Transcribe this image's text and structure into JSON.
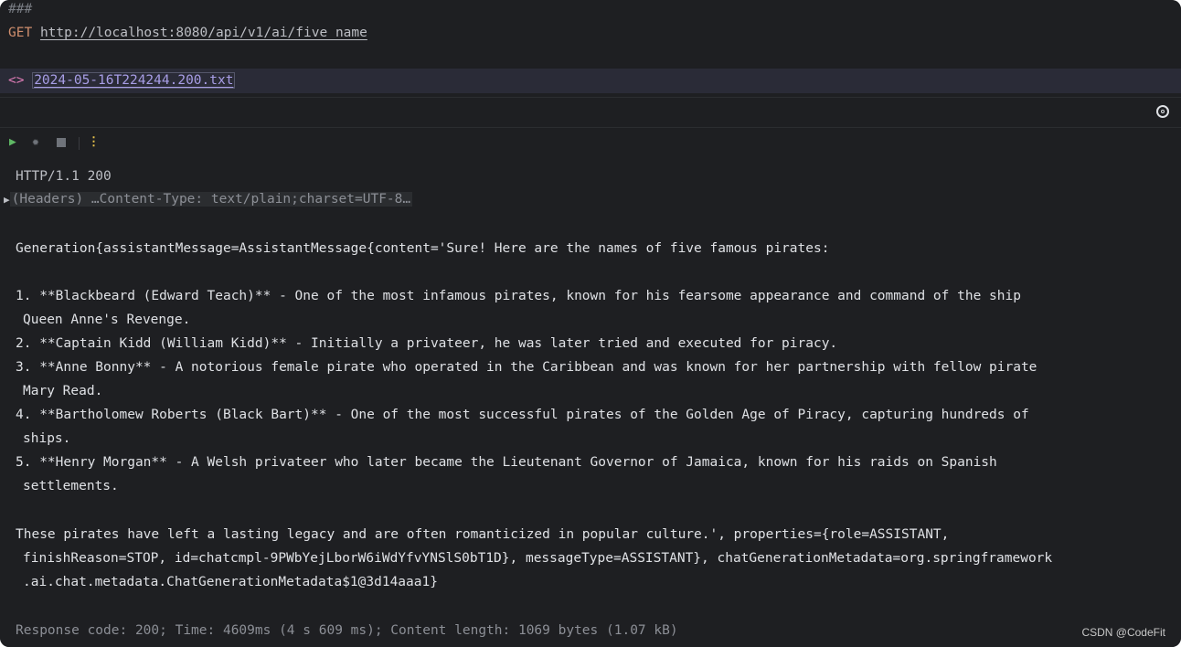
{
  "editor": {
    "comment": "###",
    "method": "GET",
    "url": "http://localhost:8080/api/v1/ai/five_name",
    "diff_marker": "<>",
    "result_file": "2024-05-16T224244.200.txt"
  },
  "toolbar": {
    "run_icon": "play-icon",
    "debug_icon": "bug-icon",
    "stop_icon": "stop-icon",
    "more_icon": "more-vertical-icon",
    "target_icon": "target-icon"
  },
  "response": {
    "status_line": "HTTP/1.1 200",
    "headers_summary": "(Headers) …Content-Type: text/plain;charset=UTF-8…",
    "body_lines": [
      "Generation{assistantMessage=AssistantMessage{content='Sure! Here are the names of five famous pirates:",
      "",
      "1. **Blackbeard (Edward Teach)** - One of the most infamous pirates, known for his fearsome appearance and command of the ship",
      "Queen Anne's Revenge.",
      "2. **Captain Kidd (William Kidd)** - Initially a privateer, he was later tried and executed for piracy.",
      "3. **Anne Bonny** - A notorious female pirate who operated in the Caribbean and was known for her partnership with fellow pirate",
      "Mary Read.",
      "4. **Bartholomew Roberts (Black Bart)** - One of the most successful pirates of the Golden Age of Piracy, capturing hundreds of",
      "ships.",
      "5. **Henry Morgan** - A Welsh privateer who later became the Lieutenant Governor of Jamaica, known for his raids on Spanish",
      "settlements.",
      "",
      "These pirates have left a lasting legacy and are often romanticized in popular culture.', properties={role=ASSISTANT,",
      "finishReason=STOP, id=chatcmpl-9PWbYejLborW6iWdYfvYNSlS0bT1D}, messageType=ASSISTANT}, chatGenerationMetadata=org.springframework",
      ".ai.chat.metadata.ChatGenerationMetadata$1@3d14aaa1}"
    ],
    "footer": "Response code: 200; Time: 4609ms (4 s 609 ms); Content length: 1069 bytes (1.07 kB)"
  },
  "watermark": "CSDN @CodeFit"
}
